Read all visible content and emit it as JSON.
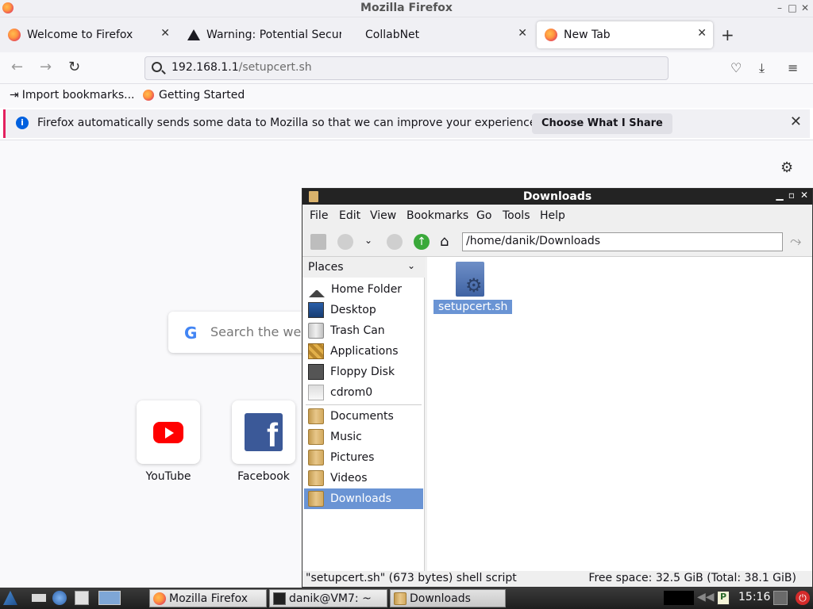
{
  "firefox": {
    "window_title": "Mozilla Firefox",
    "tabs": [
      {
        "label": "Welcome to Firefox",
        "icon": "firefox-icon"
      },
      {
        "label": "Warning: Potential Securi",
        "icon": "warning-icon"
      },
      {
        "label": "CollabNet",
        "icon": ""
      },
      {
        "label": "New Tab",
        "icon": "firefox-icon",
        "active": true
      }
    ],
    "url": {
      "host": "192.168.1.1",
      "path": "/setupcert.sh"
    },
    "bookmarks": [
      {
        "label": "Import bookmarks...",
        "icon": "import-icon"
      },
      {
        "label": "Getting Started",
        "icon": "firefox-icon"
      }
    ],
    "infobar": {
      "message": "Firefox automatically sends some data to Mozilla so that we can improve your experience.",
      "button": "Choose What I Share"
    },
    "newtab": {
      "search_placeholder": "Search the web",
      "shortcuts": [
        {
          "label": "YouTube"
        },
        {
          "label": "Facebook"
        }
      ]
    }
  },
  "filemanager": {
    "title": "Downloads",
    "menu": [
      "File",
      "Edit",
      "View",
      "Bookmarks",
      "Go",
      "Tools",
      "Help"
    ],
    "path": "/home/danik/Downloads",
    "places_header": "Places",
    "places": [
      {
        "label": "Home Folder",
        "icon": "home-icon"
      },
      {
        "label": "Desktop",
        "icon": "desktop-icon"
      },
      {
        "label": "Trash Can",
        "icon": "trash-icon"
      },
      {
        "label": "Applications",
        "icon": "applications-icon"
      },
      {
        "label": "Floppy Disk",
        "icon": "floppy-icon"
      },
      {
        "label": "cdrom0",
        "icon": "cdrom-icon"
      }
    ],
    "bookmarks": [
      {
        "label": "Documents",
        "icon": "folder-icon"
      },
      {
        "label": "Music",
        "icon": "folder-icon"
      },
      {
        "label": "Pictures",
        "icon": "folder-icon"
      },
      {
        "label": "Videos",
        "icon": "folder-icon"
      },
      {
        "label": "Downloads",
        "icon": "folder-icon",
        "selected": true
      }
    ],
    "files": [
      {
        "name": "setupcert.sh",
        "icon": "shell-script-icon",
        "selected": true
      }
    ],
    "status_left": "\"setupcert.sh\" (673 bytes) shell script",
    "status_right": "Free space: 32.5 GiB (Total: 38.1 GiB)"
  },
  "taskbar": {
    "tasks": [
      {
        "label": "Mozilla Firefox",
        "icon": "firefox-icon"
      },
      {
        "label": "danik@VM7: ~",
        "icon": "terminal-icon"
      },
      {
        "label": "Downloads",
        "icon": "folder-icon",
        "active": true
      }
    ],
    "clock": "15:16"
  }
}
